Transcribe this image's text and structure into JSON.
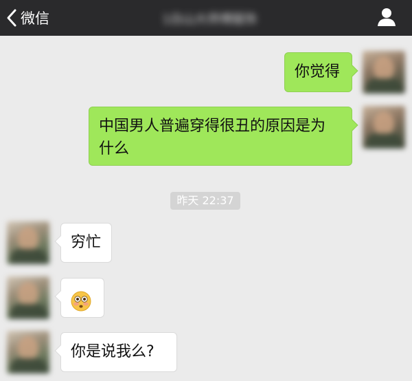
{
  "header": {
    "back_label": "微信",
    "title": "1白山大师傅服饰",
    "back_icon": "chevron-left-icon",
    "profile_icon": "person-icon",
    "background": "#2a2a2c"
  },
  "messages": [
    {
      "side": "sent",
      "text": "你觉得"
    },
    {
      "side": "sent",
      "text_line1": "中国男人普遍穿得很丑的原因是为",
      "text_line2": "什么"
    },
    {
      "side": "recv",
      "text": "穷忙"
    },
    {
      "side": "recv",
      "emoji": "flushed-face-emoji"
    },
    {
      "side": "recv",
      "text": "你是说我么?"
    }
  ],
  "timestamp": "昨天 22:37",
  "colors": {
    "sent_bubble": "#9fe75a",
    "recv_bubble": "#ffffff",
    "chat_background": "#ebebeb",
    "timestamp_bg": "#d4d4d4"
  }
}
